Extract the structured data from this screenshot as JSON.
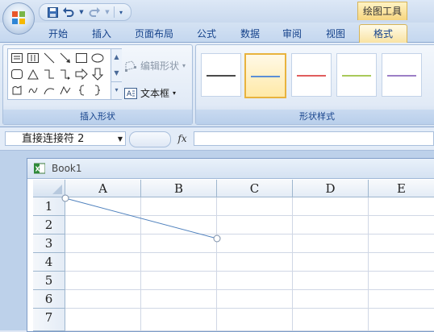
{
  "quick_access": {
    "items": [
      "save-icon",
      "undo-icon",
      "redo-icon",
      "customize-icon"
    ]
  },
  "context_tab": {
    "label": "绘图工具"
  },
  "tabs": [
    {
      "label": "开始"
    },
    {
      "label": "插入"
    },
    {
      "label": "页面布局"
    },
    {
      "label": "公式"
    },
    {
      "label": "数据"
    },
    {
      "label": "审阅"
    },
    {
      "label": "视图"
    },
    {
      "label": "格式",
      "active": true
    }
  ],
  "ribbon": {
    "insert_shapes": {
      "label": "插入形状",
      "edit_shape": "编辑形状",
      "text_box": "文本框"
    },
    "shape_styles": {
      "label": "形状样式",
      "line_colors": [
        "#4a4a4a",
        "#5b8fd6",
        "#e05d5d",
        "#a9c95a",
        "#9c7fc6"
      ]
    }
  },
  "formula_bar": {
    "name_box": "直接连接符 2",
    "fx": "fx",
    "value": ""
  },
  "workbook": {
    "title": "Book1",
    "columns": [
      "A",
      "B",
      "C",
      "D",
      "E"
    ],
    "rows": [
      "1",
      "2",
      "3",
      "4",
      "5",
      "6",
      "7"
    ]
  },
  "colors": {
    "accent": "#15428b",
    "selected_tab": "#f9e3a3",
    "connector": "#4f81bd"
  }
}
